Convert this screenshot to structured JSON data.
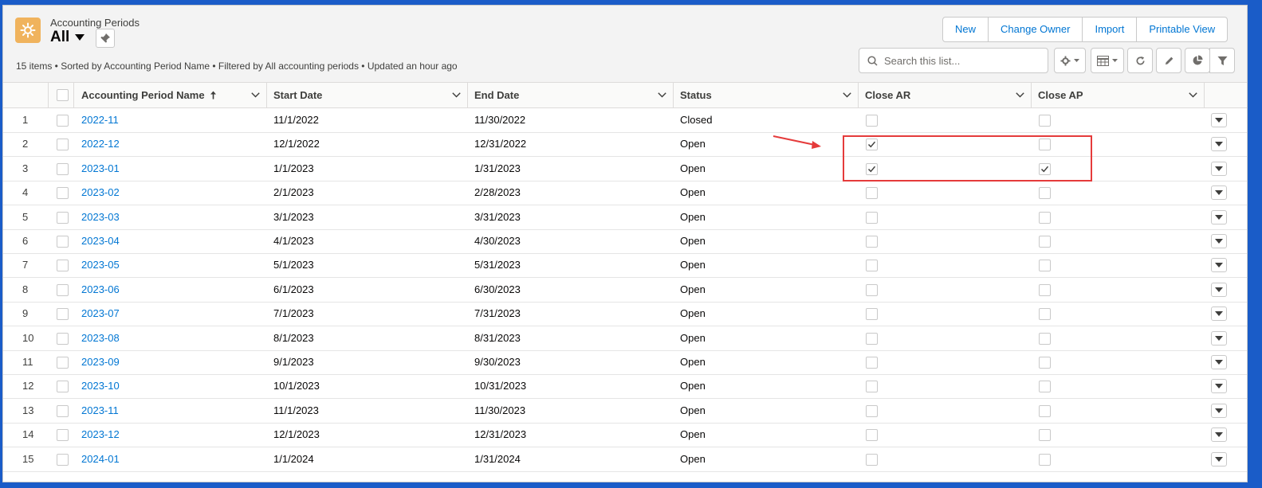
{
  "header": {
    "object_label": "Accounting Periods",
    "view_name": "All",
    "summary": "15 items • Sorted by Accounting Period Name • Filtered by All accounting periods • Updated an hour ago"
  },
  "actions": [
    "New",
    "Change Owner",
    "Import",
    "Printable View"
  ],
  "search": {
    "placeholder": "Search this list..."
  },
  "columns": {
    "name": "Accounting Period Name",
    "start": "Start Date",
    "end": "End Date",
    "status": "Status",
    "close_ar": "Close AR",
    "close_ap": "Close AP"
  },
  "rows": [
    {
      "num": "1",
      "name": "2022-11",
      "start": "11/1/2022",
      "end": "11/30/2022",
      "status": "Closed",
      "close_ar": false,
      "close_ap": false
    },
    {
      "num": "2",
      "name": "2022-12",
      "start": "12/1/2022",
      "end": "12/31/2022",
      "status": "Open",
      "close_ar": true,
      "close_ap": false
    },
    {
      "num": "3",
      "name": "2023-01",
      "start": "1/1/2023",
      "end": "1/31/2023",
      "status": "Open",
      "close_ar": true,
      "close_ap": true
    },
    {
      "num": "4",
      "name": "2023-02",
      "start": "2/1/2023",
      "end": "2/28/2023",
      "status": "Open",
      "close_ar": false,
      "close_ap": false
    },
    {
      "num": "5",
      "name": "2023-03",
      "start": "3/1/2023",
      "end": "3/31/2023",
      "status": "Open",
      "close_ar": false,
      "close_ap": false
    },
    {
      "num": "6",
      "name": "2023-04",
      "start": "4/1/2023",
      "end": "4/30/2023",
      "status": "Open",
      "close_ar": false,
      "close_ap": false
    },
    {
      "num": "7",
      "name": "2023-05",
      "start": "5/1/2023",
      "end": "5/31/2023",
      "status": "Open",
      "close_ar": false,
      "close_ap": false
    },
    {
      "num": "8",
      "name": "2023-06",
      "start": "6/1/2023",
      "end": "6/30/2023",
      "status": "Open",
      "close_ar": false,
      "close_ap": false
    },
    {
      "num": "9",
      "name": "2023-07",
      "start": "7/1/2023",
      "end": "7/31/2023",
      "status": "Open",
      "close_ar": false,
      "close_ap": false
    },
    {
      "num": "10",
      "name": "2023-08",
      "start": "8/1/2023",
      "end": "8/31/2023",
      "status": "Open",
      "close_ar": false,
      "close_ap": false
    },
    {
      "num": "11",
      "name": "2023-09",
      "start": "9/1/2023",
      "end": "9/30/2023",
      "status": "Open",
      "close_ar": false,
      "close_ap": false
    },
    {
      "num": "12",
      "name": "2023-10",
      "start": "10/1/2023",
      "end": "10/31/2023",
      "status": "Open",
      "close_ar": false,
      "close_ap": false
    },
    {
      "num": "13",
      "name": "2023-11",
      "start": "11/1/2023",
      "end": "11/30/2023",
      "status": "Open",
      "close_ar": false,
      "close_ap": false
    },
    {
      "num": "14",
      "name": "2023-12",
      "start": "12/1/2023",
      "end": "12/31/2023",
      "status": "Open",
      "close_ar": false,
      "close_ap": false
    },
    {
      "num": "15",
      "name": "2024-01",
      "start": "1/1/2024",
      "end": "1/31/2024",
      "status": "Open",
      "close_ar": false,
      "close_ap": false
    }
  ],
  "colors": {
    "link": "#0176d3",
    "app_icon": "#f0b35d",
    "annotation": "#e53b3b"
  }
}
